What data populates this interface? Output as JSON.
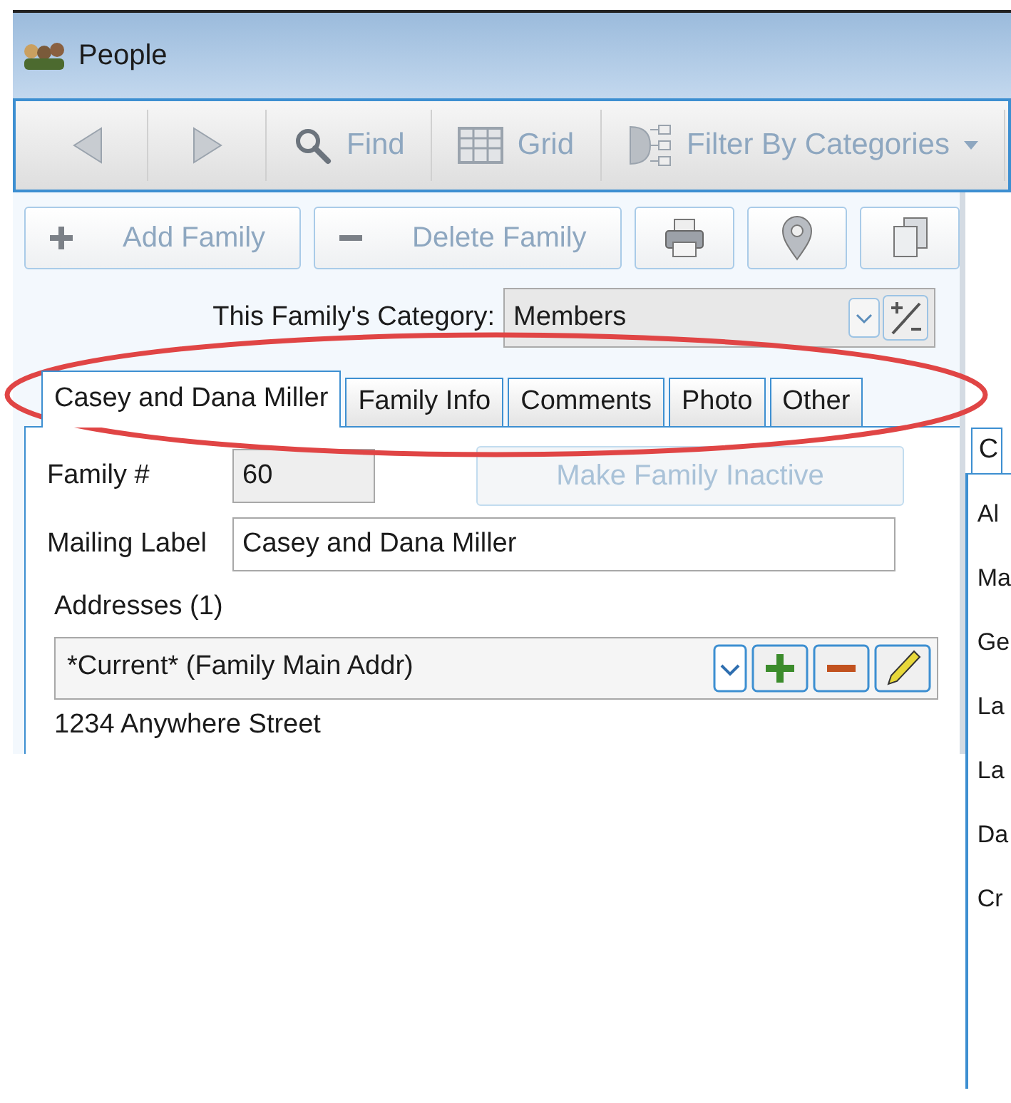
{
  "window": {
    "title": "People"
  },
  "toolbar": [
    {
      "kind": "back"
    },
    {
      "kind": "forward"
    },
    {
      "kind": "find",
      "label": "Find"
    },
    {
      "kind": "grid",
      "label": "Grid"
    },
    {
      "kind": "filter",
      "label": "Filter By Categories"
    }
  ],
  "family_actions": [
    {
      "kind": "add",
      "label": "Add Family"
    },
    {
      "kind": "delete",
      "label": "Delete Family"
    },
    {
      "kind": "print"
    },
    {
      "kind": "map"
    },
    {
      "kind": "copy"
    }
  ],
  "category": {
    "label": "This Family's Category:",
    "value": "Members"
  },
  "tabs": [
    {
      "label": "Casey and Dana Miller",
      "selected": true
    },
    {
      "label": "Family Info",
      "selected": false
    },
    {
      "label": "Comments",
      "selected": false
    },
    {
      "label": "Photo",
      "selected": false
    },
    {
      "label": "Other",
      "selected": false
    }
  ],
  "form": {
    "family_number": {
      "label": "Family #",
      "value": "60"
    },
    "inactive_button": {
      "label": "Make Family Inactive",
      "disabled": true
    },
    "mailing_label": {
      "label": "Mailing Label",
      "value": "Casey and Dana Miller"
    },
    "addresses": {
      "label": "Addresses (1)",
      "value": "*Current* (Family Main Addr)",
      "lines": [
        "1234 Anywhere Street"
      ]
    }
  },
  "side_panel": {
    "tabs": [
      {
        "label": "C",
        "selected": true
      }
    ],
    "labels": [
      "Al",
      "Ma",
      "Ge",
      "La",
      "La",
      "Da",
      "Cr"
    ]
  }
}
